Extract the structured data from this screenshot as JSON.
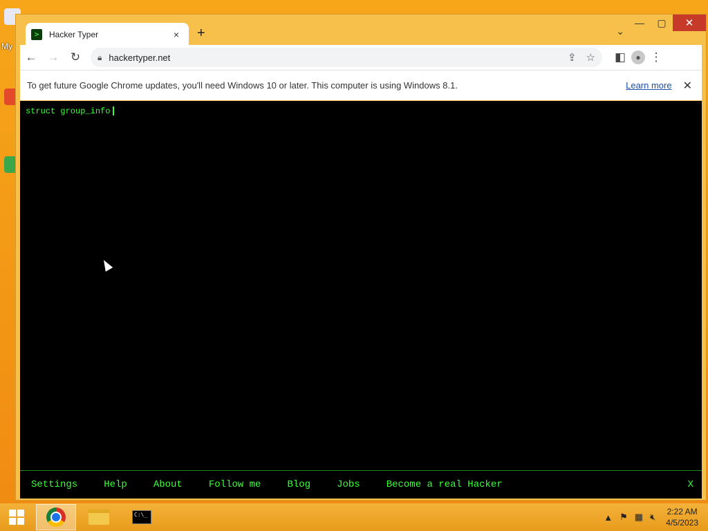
{
  "desktop": {
    "label": "My"
  },
  "window": {
    "tab": {
      "title": "Hacker Typer",
      "favicon": ">",
      "close": "×"
    },
    "new_tab": "+",
    "tab_dropdown": "⌄",
    "controls": {
      "minimize": "—",
      "maximize": "▢",
      "close": "✕"
    }
  },
  "toolbar": {
    "back": "←",
    "forward": "→",
    "reload": "↻",
    "url": "hackertyper.net",
    "share": "⇪",
    "star": "☆",
    "sidepanel": "◧",
    "menu": "⋮"
  },
  "infobar": {
    "message": "To get future Google Chrome updates, you'll need Windows 10 or later. This computer is using Windows 8.1.",
    "link": "Learn more",
    "close": "✕"
  },
  "terminal": {
    "text": "struct group_info",
    "menu": [
      "Settings",
      "Help",
      "About",
      "Follow me",
      "Blog",
      "Jobs",
      "Become a real Hacker"
    ],
    "close": "X"
  },
  "taskbar": {
    "cmd_icon_text": "C:\\_",
    "clock": {
      "time": "2:22 AM",
      "date": "4/5/2023"
    }
  }
}
